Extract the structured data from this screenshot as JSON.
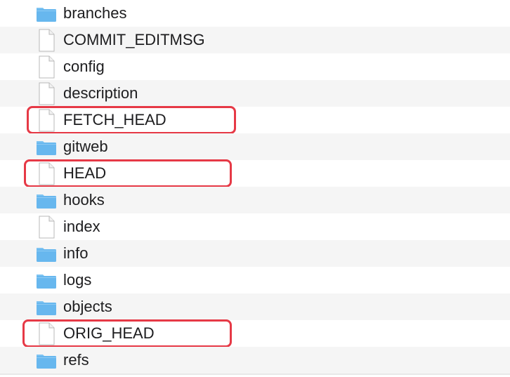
{
  "files": [
    {
      "name": "branches",
      "kind": "folder",
      "highlighted": false
    },
    {
      "name": "COMMIT_EDITMSG",
      "kind": "file",
      "highlighted": false
    },
    {
      "name": "config",
      "kind": "file",
      "highlighted": false
    },
    {
      "name": "description",
      "kind": "file",
      "highlighted": false
    },
    {
      "name": "FETCH_HEAD",
      "kind": "file",
      "highlighted": true
    },
    {
      "name": "gitweb",
      "kind": "folder",
      "highlighted": false
    },
    {
      "name": "HEAD",
      "kind": "file",
      "highlighted": true
    },
    {
      "name": "hooks",
      "kind": "folder",
      "highlighted": false
    },
    {
      "name": "index",
      "kind": "file",
      "highlighted": false
    },
    {
      "name": "info",
      "kind": "folder",
      "highlighted": false
    },
    {
      "name": "logs",
      "kind": "folder",
      "highlighted": false
    },
    {
      "name": "objects",
      "kind": "folder",
      "highlighted": false
    },
    {
      "name": "ORIG_HEAD",
      "kind": "file",
      "highlighted": true
    },
    {
      "name": "refs",
      "kind": "folder",
      "highlighted": false
    }
  ],
  "icons": {
    "folder": "folder-icon",
    "file": "document-icon"
  },
  "colors": {
    "highlight": "#e63946",
    "folder_body": "#67b7ee",
    "folder_tab": "#7fc4f2",
    "stripe": "#f5f5f5"
  }
}
